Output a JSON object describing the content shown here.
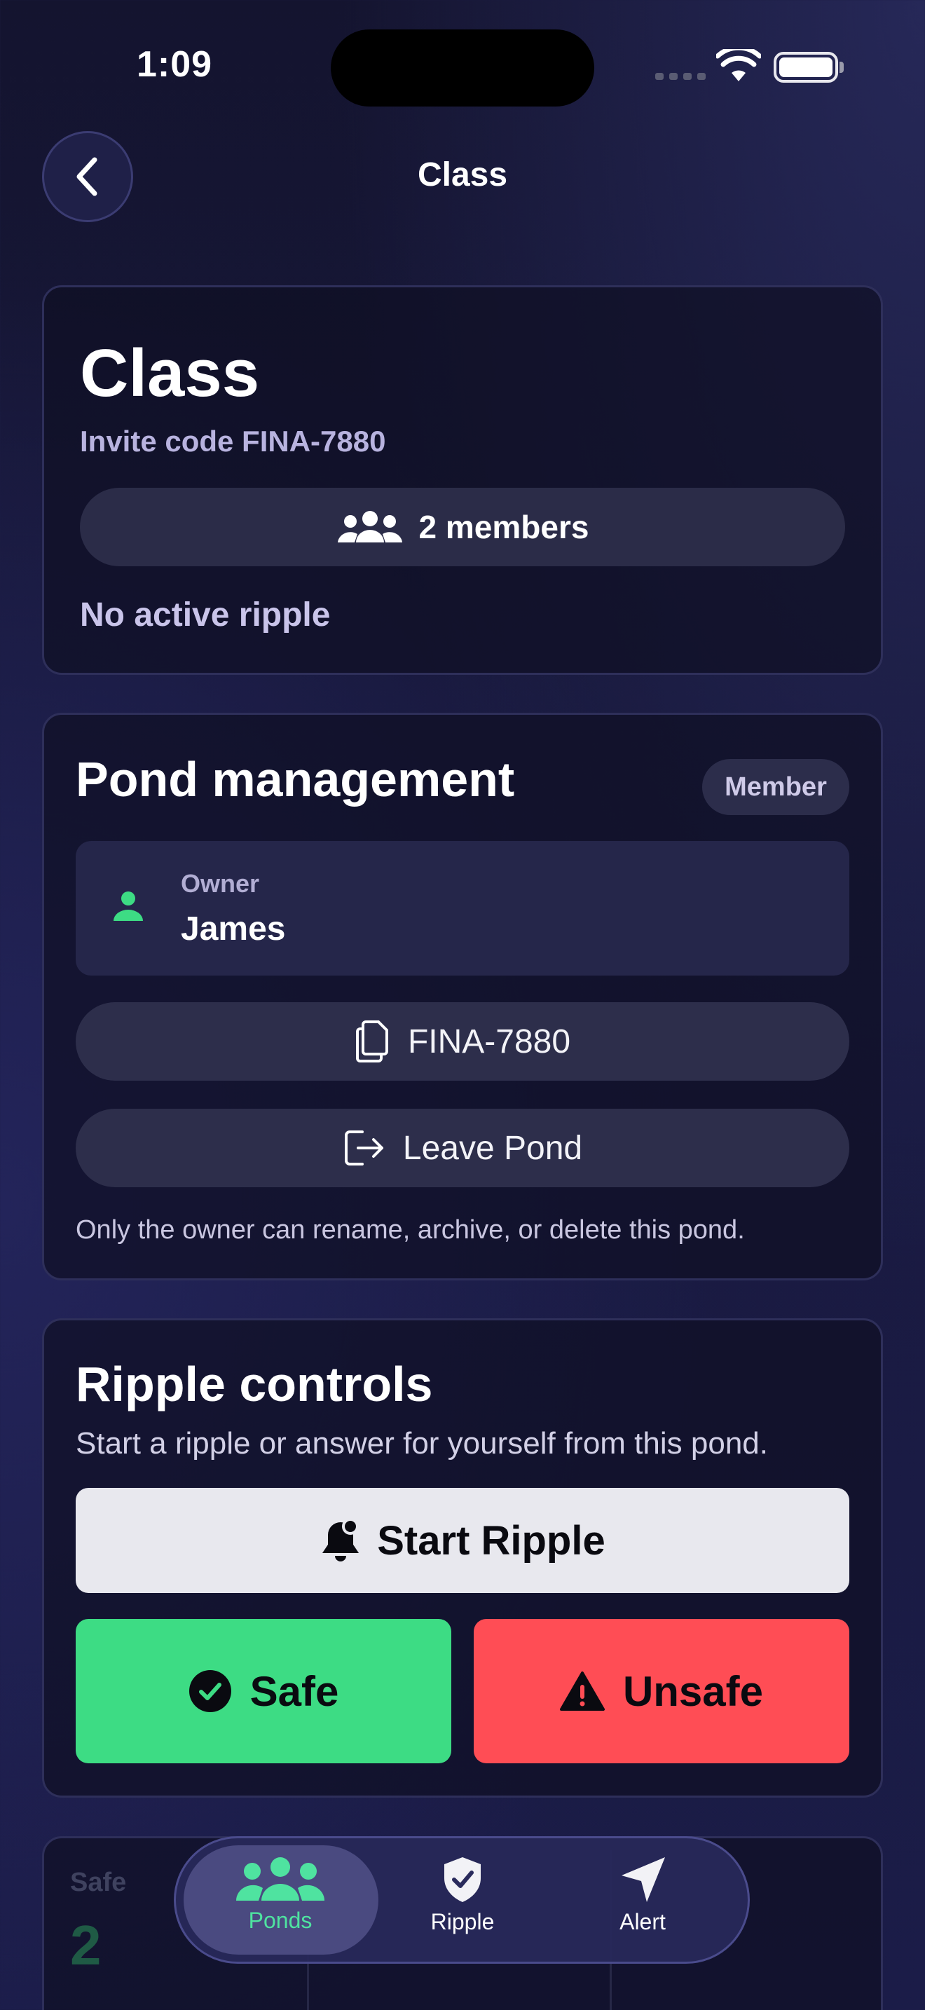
{
  "status_bar": {
    "time": "1:09"
  },
  "nav": {
    "title": "Class"
  },
  "pond_header": {
    "name": "Class",
    "invite_code": "Invite code FINA-7880",
    "members": "2 members",
    "ripple_status": "No active ripple"
  },
  "management": {
    "title": "Pond management",
    "role_badge": "Member",
    "owner_label": "Owner",
    "owner_name": "James",
    "copy_code": "FINA-7880",
    "leave": "Leave Pond",
    "note": "Only the owner can rename, archive, or delete this pond."
  },
  "ripple_controls": {
    "title": "Ripple controls",
    "subtitle": "Start a ripple or answer for yourself from this pond.",
    "start": "Start Ripple",
    "safe": "Safe",
    "unsafe": "Unsafe"
  },
  "stats": {
    "safe_label": "Safe",
    "safe_value": "2"
  },
  "tabbar": {
    "tabs": [
      {
        "label": "Ponds",
        "icon": "people-icon",
        "active": true
      },
      {
        "label": "Ripple",
        "icon": "shield-check-icon",
        "active": false
      },
      {
        "label": "Alert",
        "icon": "location-arrow-icon",
        "active": false
      }
    ]
  },
  "colors": {
    "accent_green": "#3ddc84",
    "danger_red": "#ff4d55",
    "background": "#14142f"
  }
}
